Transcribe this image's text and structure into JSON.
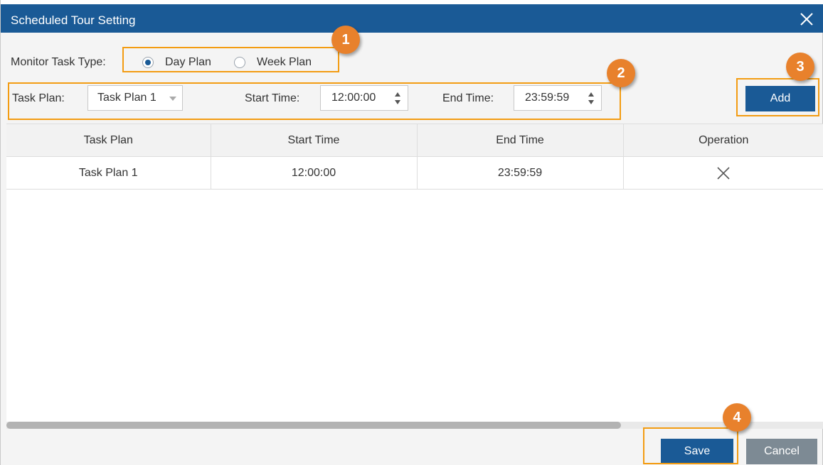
{
  "dialog": {
    "title": "Scheduled Tour Setting",
    "close_icon": "close-icon"
  },
  "task_type": {
    "label": "Monitor Task Type:",
    "options": [
      {
        "label": "Day Plan",
        "checked": true
      },
      {
        "label": "Week Plan",
        "checked": false
      }
    ]
  },
  "task_row": {
    "task_plan_label": "Task Plan:",
    "task_plan_value": "Task Plan 1",
    "start_label": "Start Time:",
    "start_value": "12:00:00",
    "end_label": "End Time:",
    "end_value": "23:59:59",
    "add_label": "Add"
  },
  "table": {
    "headers": [
      "Task Plan",
      "Start Time",
      "End Time",
      "Operation"
    ],
    "rows": [
      {
        "task_plan": "Task Plan 1",
        "start": "12:00:00",
        "end": "23:59:59",
        "operation_icon": "delete-x-icon"
      }
    ]
  },
  "footer": {
    "save_label": "Save",
    "cancel_label": "Cancel"
  },
  "annotations": {
    "badges": [
      "1",
      "2",
      "3",
      "4"
    ]
  },
  "colors": {
    "primary": "#1a5a96",
    "secondary": "#7d8a94",
    "highlight": "#f39c12",
    "badge": "#e8812c"
  }
}
